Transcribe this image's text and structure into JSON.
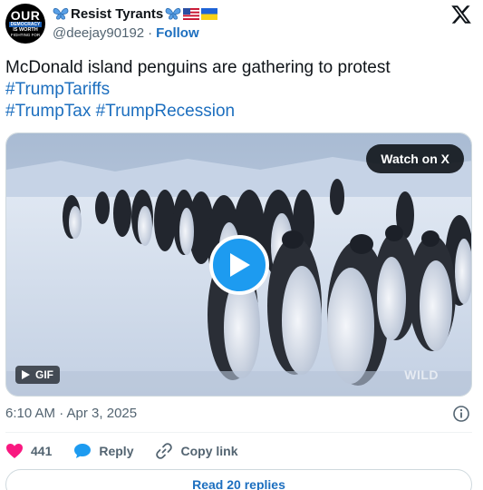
{
  "author": {
    "avatar_text": [
      "OUR",
      "DEMOCRACY",
      "IS WORTH",
      "FIGHTING FOR"
    ],
    "display_name": "Resist Tyrants",
    "name_emojis": [
      "butterfly-emoji",
      "butterfly-emoji",
      "us-flag-emoji",
      "ukraine-flag-emoji"
    ],
    "handle": "@deejay90192",
    "separator": "·",
    "follow_label": "Follow"
  },
  "tweet": {
    "text_line": "McDonald island penguins are gathering to protest",
    "hashtags": [
      "#TrumpTariffs",
      "#TrumpTax",
      "#TrumpRecession"
    ]
  },
  "media": {
    "watch_label": "Watch on X",
    "gif_label": "GIF",
    "watermark": "WILD",
    "colors": {
      "sky": "#b9c8dc",
      "ice": "#dfe7f2",
      "play": "#1d9bf0"
    }
  },
  "meta": {
    "timestamp": "6:10 AM · Apr 3, 2025"
  },
  "actions": {
    "like_count": "441",
    "reply_label": "Reply",
    "copy_label": "Copy link",
    "like_color": "#f91880",
    "reply_color": "#1d9bf0"
  },
  "footer": {
    "read_replies_label": "Read 20 replies"
  }
}
